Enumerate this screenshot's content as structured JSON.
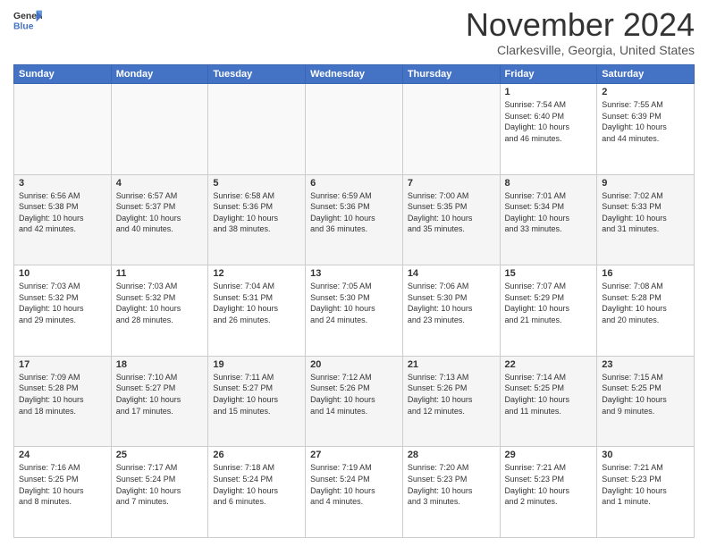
{
  "header": {
    "logo_line1": "General",
    "logo_line2": "Blue",
    "month": "November 2024",
    "location": "Clarkesville, Georgia, United States"
  },
  "weekdays": [
    "Sunday",
    "Monday",
    "Tuesday",
    "Wednesday",
    "Thursday",
    "Friday",
    "Saturday"
  ],
  "weeks": [
    [
      {
        "day": "",
        "info": ""
      },
      {
        "day": "",
        "info": ""
      },
      {
        "day": "",
        "info": ""
      },
      {
        "day": "",
        "info": ""
      },
      {
        "day": "",
        "info": ""
      },
      {
        "day": "1",
        "info": "Sunrise: 7:54 AM\nSunset: 6:40 PM\nDaylight: 10 hours\nand 46 minutes."
      },
      {
        "day": "2",
        "info": "Sunrise: 7:55 AM\nSunset: 6:39 PM\nDaylight: 10 hours\nand 44 minutes."
      }
    ],
    [
      {
        "day": "3",
        "info": "Sunrise: 6:56 AM\nSunset: 5:38 PM\nDaylight: 10 hours\nand 42 minutes."
      },
      {
        "day": "4",
        "info": "Sunrise: 6:57 AM\nSunset: 5:37 PM\nDaylight: 10 hours\nand 40 minutes."
      },
      {
        "day": "5",
        "info": "Sunrise: 6:58 AM\nSunset: 5:36 PM\nDaylight: 10 hours\nand 38 minutes."
      },
      {
        "day": "6",
        "info": "Sunrise: 6:59 AM\nSunset: 5:36 PM\nDaylight: 10 hours\nand 36 minutes."
      },
      {
        "day": "7",
        "info": "Sunrise: 7:00 AM\nSunset: 5:35 PM\nDaylight: 10 hours\nand 35 minutes."
      },
      {
        "day": "8",
        "info": "Sunrise: 7:01 AM\nSunset: 5:34 PM\nDaylight: 10 hours\nand 33 minutes."
      },
      {
        "day": "9",
        "info": "Sunrise: 7:02 AM\nSunset: 5:33 PM\nDaylight: 10 hours\nand 31 minutes."
      }
    ],
    [
      {
        "day": "10",
        "info": "Sunrise: 7:03 AM\nSunset: 5:32 PM\nDaylight: 10 hours\nand 29 minutes."
      },
      {
        "day": "11",
        "info": "Sunrise: 7:03 AM\nSunset: 5:32 PM\nDaylight: 10 hours\nand 28 minutes."
      },
      {
        "day": "12",
        "info": "Sunrise: 7:04 AM\nSunset: 5:31 PM\nDaylight: 10 hours\nand 26 minutes."
      },
      {
        "day": "13",
        "info": "Sunrise: 7:05 AM\nSunset: 5:30 PM\nDaylight: 10 hours\nand 24 minutes."
      },
      {
        "day": "14",
        "info": "Sunrise: 7:06 AM\nSunset: 5:30 PM\nDaylight: 10 hours\nand 23 minutes."
      },
      {
        "day": "15",
        "info": "Sunrise: 7:07 AM\nSunset: 5:29 PM\nDaylight: 10 hours\nand 21 minutes."
      },
      {
        "day": "16",
        "info": "Sunrise: 7:08 AM\nSunset: 5:28 PM\nDaylight: 10 hours\nand 20 minutes."
      }
    ],
    [
      {
        "day": "17",
        "info": "Sunrise: 7:09 AM\nSunset: 5:28 PM\nDaylight: 10 hours\nand 18 minutes."
      },
      {
        "day": "18",
        "info": "Sunrise: 7:10 AM\nSunset: 5:27 PM\nDaylight: 10 hours\nand 17 minutes."
      },
      {
        "day": "19",
        "info": "Sunrise: 7:11 AM\nSunset: 5:27 PM\nDaylight: 10 hours\nand 15 minutes."
      },
      {
        "day": "20",
        "info": "Sunrise: 7:12 AM\nSunset: 5:26 PM\nDaylight: 10 hours\nand 14 minutes."
      },
      {
        "day": "21",
        "info": "Sunrise: 7:13 AM\nSunset: 5:26 PM\nDaylight: 10 hours\nand 12 minutes."
      },
      {
        "day": "22",
        "info": "Sunrise: 7:14 AM\nSunset: 5:25 PM\nDaylight: 10 hours\nand 11 minutes."
      },
      {
        "day": "23",
        "info": "Sunrise: 7:15 AM\nSunset: 5:25 PM\nDaylight: 10 hours\nand 9 minutes."
      }
    ],
    [
      {
        "day": "24",
        "info": "Sunrise: 7:16 AM\nSunset: 5:25 PM\nDaylight: 10 hours\nand 8 minutes."
      },
      {
        "day": "25",
        "info": "Sunrise: 7:17 AM\nSunset: 5:24 PM\nDaylight: 10 hours\nand 7 minutes."
      },
      {
        "day": "26",
        "info": "Sunrise: 7:18 AM\nSunset: 5:24 PM\nDaylight: 10 hours\nand 6 minutes."
      },
      {
        "day": "27",
        "info": "Sunrise: 7:19 AM\nSunset: 5:24 PM\nDaylight: 10 hours\nand 4 minutes."
      },
      {
        "day": "28",
        "info": "Sunrise: 7:20 AM\nSunset: 5:23 PM\nDaylight: 10 hours\nand 3 minutes."
      },
      {
        "day": "29",
        "info": "Sunrise: 7:21 AM\nSunset: 5:23 PM\nDaylight: 10 hours\nand 2 minutes."
      },
      {
        "day": "30",
        "info": "Sunrise: 7:21 AM\nSunset: 5:23 PM\nDaylight: 10 hours\nand 1 minute."
      }
    ]
  ]
}
